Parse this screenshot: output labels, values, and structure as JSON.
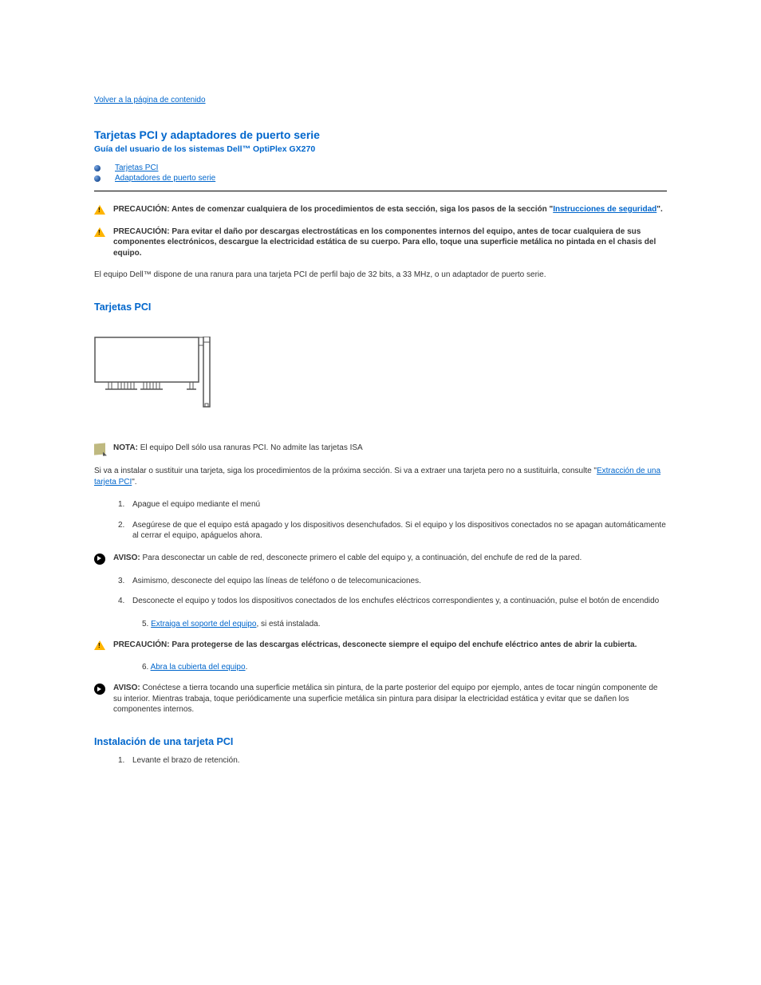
{
  "nav": {
    "back_link": "Volver a la página de contenido"
  },
  "header": {
    "title": "Tarjetas PCI y adaptadores de puerto serie",
    "subtitle": "Guía del usuario de los sistemas Dell™ OptiPlex GX270"
  },
  "toc": {
    "items": [
      {
        "label": "Tarjetas PCI"
      },
      {
        "label": "Adaptadores de puerto serie"
      }
    ]
  },
  "callouts": {
    "precaucion_label": "PRECAUCIÓN:",
    "aviso_label": "AVISO:",
    "nota_label": "NOTA:",
    "precaucion1_pre": " Antes de comenzar cualquiera de los procedimientos de esta sección, siga los pasos de la sección \"",
    "precaucion1_link": "Instrucciones de seguridad",
    "precaucion1_post": "\".",
    "precaucion2": " Para evitar el daño por descargas electrostáticas en los componentes internos del equipo, antes de tocar cualquiera de sus componentes electrónicos, descargue la electricidad estática de su cuerpo. Para ello, toque una superficie metálica no pintada en el chasis del equipo.",
    "nota1": " El equipo Dell sólo usa ranuras PCI. No admite las tarjetas ISA",
    "aviso1": " Para desconectar un cable de red, desconecte primero el cable del equipo y, a continuación, del enchufe de red de la pared.",
    "precaucion3": " Para protegerse de las descargas eléctricas, desconecte siempre el equipo del enchufe eléctrico antes de abrir la cubierta.",
    "aviso2": " Conéctese a tierra tocando una superficie metálica sin pintura, de la parte posterior del equipo por ejemplo, antes de tocar ningún componente de su interior. Mientras trabaja, toque periódicamente una superficie metálica sin pintura para disipar la electricidad estática y evitar que se dañen los componentes internos."
  },
  "body": {
    "intro": "El equipo Dell™ dispone de una ranura para una tarjeta PCI de perfil bajo de 32 bits, a 33 MHz, o un adaptador de puerto serie.",
    "section_pci_title": "Tarjetas PCI",
    "install_replace_pre": "Si va a instalar o sustituir una tarjeta, siga los procedimientos de la próxima sección. Si va a extraer una tarjeta pero no a sustituirla, consulte \"",
    "install_replace_link": "Extracción de una tarjeta PCI",
    "install_replace_post": "\"."
  },
  "steps": {
    "s1_num": "1.",
    "s1": "Apague el equipo mediante el menú",
    "s1b_num": "2.",
    "s1b": "Asegúrese de que el equipo está apagado y los dispositivos desenchufados. Si el equipo y los dispositivos conectados no se apagan automáticamente al cerrar el equipo, apáguelos ahora.",
    "s3_num": "3.",
    "s3": "Asimismo, desconecte del equipo las líneas de teléfono o de telecomunicaciones.",
    "s4_num": "4.",
    "s4": "Desconecte el equipo y todos los dispositivos conectados de los enchufes eléctricos correspondientes y, a continuación, pulse el botón de encendido",
    "s5_num": "5.",
    "s5_link": "Extraiga el soporte del equipo",
    "s5_post": ", si está instalada.",
    "s6_num": "6.",
    "s6_link": "Abra la cubierta del equipo",
    "s6_post": "."
  },
  "section_install": {
    "title": "Instalación de una tarjeta PCI",
    "s1_num": "1.",
    "s1": "Levante el brazo de retención."
  }
}
